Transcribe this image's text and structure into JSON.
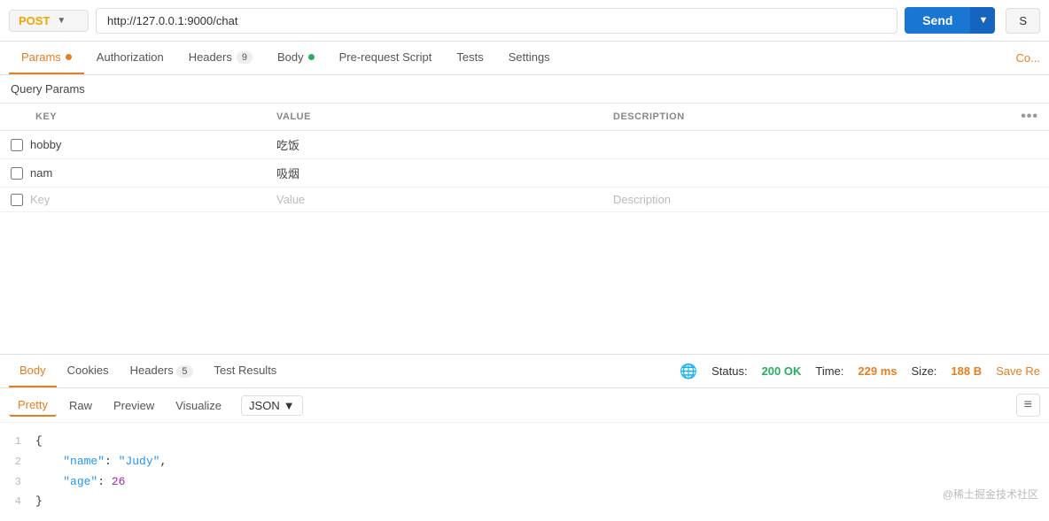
{
  "topbar": {
    "method": "POST",
    "method_chevron": "▼",
    "url": "http://127.0.0.1:9000/chat",
    "send_label": "Send",
    "send_dropdown_icon": "▼",
    "save_label": "S"
  },
  "tabs": {
    "items": [
      {
        "id": "params",
        "label": "Params",
        "dot": "orange",
        "active": true
      },
      {
        "id": "authorization",
        "label": "Authorization",
        "dot": null,
        "active": false
      },
      {
        "id": "headers",
        "label": "Headers",
        "badge": "9",
        "dot": null,
        "active": false
      },
      {
        "id": "body",
        "label": "Body",
        "dot": "green",
        "active": false
      },
      {
        "id": "prerequest",
        "label": "Pre-request Script",
        "dot": null,
        "active": false
      },
      {
        "id": "tests",
        "label": "Tests",
        "dot": null,
        "active": false
      },
      {
        "id": "settings",
        "label": "Settings",
        "dot": null,
        "active": false
      }
    ],
    "right_label": "Co..."
  },
  "query_params": {
    "section_title": "Query Params",
    "columns": {
      "key": "KEY",
      "value": "VALUE",
      "description": "DESCRIPTION"
    },
    "rows": [
      {
        "key": "hobby",
        "value": "吃饭",
        "description": ""
      },
      {
        "key": "nam",
        "value": "吸烟",
        "description": ""
      }
    ],
    "placeholder": {
      "key": "Key",
      "value": "Value",
      "description": "Description"
    }
  },
  "response": {
    "tabs": [
      {
        "id": "body",
        "label": "Body",
        "active": true
      },
      {
        "id": "cookies",
        "label": "Cookies",
        "active": false
      },
      {
        "id": "headers",
        "label": "Headers",
        "badge": "5",
        "active": false
      },
      {
        "id": "test_results",
        "label": "Test Results",
        "active": false
      }
    ],
    "status_label": "Status:",
    "status_value": "200 OK",
    "time_label": "Time:",
    "time_value": "229 ms",
    "size_label": "Size:",
    "size_value": "188 B",
    "save_label": "Save Re",
    "format_tabs": [
      "Pretty",
      "Raw",
      "Preview",
      "Visualize"
    ],
    "active_format": "Pretty",
    "json_selector": "JSON",
    "code": [
      {
        "line": 1,
        "text": "{",
        "parts": [
          {
            "type": "brace",
            "text": "{"
          }
        ]
      },
      {
        "line": 2,
        "text": "    \"name\": \"Judy\",",
        "parts": [
          {
            "type": "indent",
            "text": "    "
          },
          {
            "type": "key",
            "text": "\"name\""
          },
          {
            "type": "plain",
            "text": ": "
          },
          {
            "type": "val",
            "text": "\"Judy\""
          },
          {
            "type": "plain",
            "text": ","
          }
        ]
      },
      {
        "line": 3,
        "text": "    \"age\": 26",
        "parts": [
          {
            "type": "indent",
            "text": "    "
          },
          {
            "type": "key",
            "text": "\"age\""
          },
          {
            "type": "plain",
            "text": ": "
          },
          {
            "type": "num",
            "text": "26"
          }
        ]
      },
      {
        "line": 4,
        "text": "}",
        "parts": [
          {
            "type": "brace",
            "text": "}"
          }
        ]
      }
    ]
  },
  "watermark": "@稀土掘金技术社区"
}
